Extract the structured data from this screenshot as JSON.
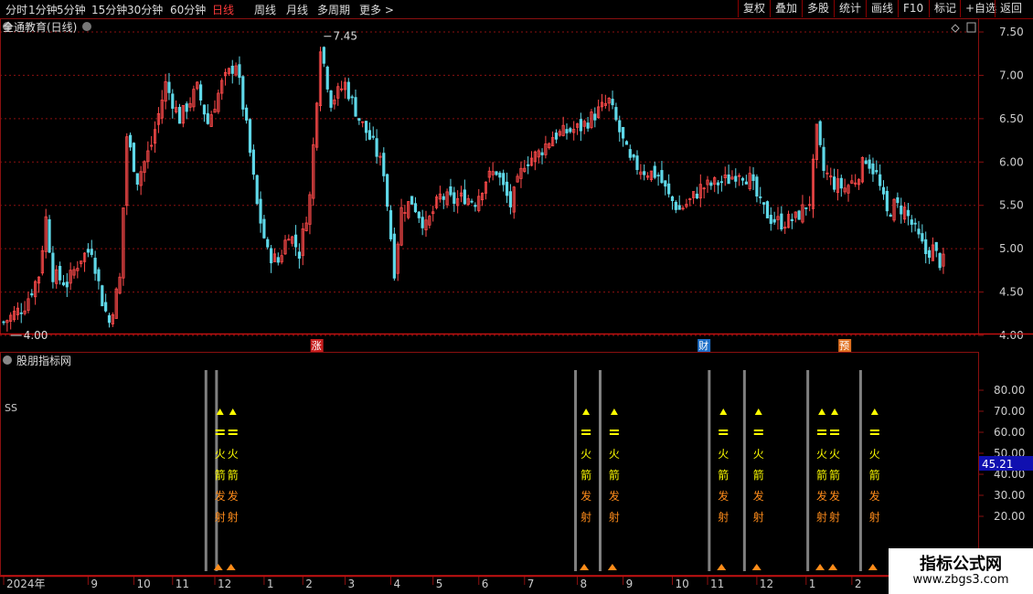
{
  "toolbar": {
    "periods": [
      "分时",
      "1分钟",
      "5分钟",
      "15分钟",
      "30分钟",
      "60分钟",
      "日线",
      "周线",
      "月线",
      "多周期",
      "更多"
    ],
    "active_period": "日线",
    "more_arrow": ">",
    "buttons": [
      "复权",
      "叠加",
      "多股",
      "统计",
      "画线",
      "F10",
      "标记",
      "+自选",
      "返回"
    ]
  },
  "main_panel": {
    "title": "全通教育(日线)",
    "max_label": "7.45",
    "min_label": "4.00",
    "event_tags": [
      {
        "text": "涨",
        "index": 89,
        "color": "#c81e1e"
      },
      {
        "text": "财",
        "index": 199,
        "color": "#1e6fc8"
      },
      {
        "text": "预",
        "index": 239,
        "color": "#e07020"
      }
    ]
  },
  "sub_panel": {
    "title": "股朋指标网",
    "label": "SS",
    "current_value": "45.21",
    "signal_text": [
      "火",
      "箭",
      "发",
      "射"
    ]
  },
  "watermark": {
    "line1": "指标公式网",
    "line2": "www.zbgs3.com"
  },
  "colors": {
    "up": "#ff4a4a",
    "down": "#5fd8e8",
    "grid": "#8a1010",
    "axis_text": "#cccccc",
    "signal_yellow": "#ffff00",
    "signal_orange": "#ff8c1a",
    "signal_bar": "#808080"
  },
  "chart_data": [
    {
      "type": "candlestick",
      "title": "全通教育(日线)",
      "ylim": [
        3.9,
        7.6
      ],
      "yticks": [
        "4.00",
        "4.50",
        "5.00",
        "5.50",
        "6.00",
        "6.50",
        "7.00",
        "7.50"
      ],
      "grid": true,
      "x_ticks": [
        {
          "label": "2024年",
          "index": 0
        },
        {
          "label": "9",
          "index": 24
        },
        {
          "label": "10",
          "index": 37
        },
        {
          "label": "11",
          "index": 48
        },
        {
          "label": "12",
          "index": 60
        },
        {
          "label": "1",
          "index": 74
        },
        {
          "label": "2",
          "index": 85
        },
        {
          "label": "3",
          "index": 97
        },
        {
          "label": "4",
          "index": 110
        },
        {
          "label": "5",
          "index": 122
        },
        {
          "label": "6",
          "index": 135
        },
        {
          "label": "7",
          "index": 148
        },
        {
          "label": "8",
          "index": 163
        },
        {
          "label": "9",
          "index": 176
        },
        {
          "label": "10",
          "index": 190
        },
        {
          "label": "11",
          "index": 200
        },
        {
          "label": "12",
          "index": 214
        },
        {
          "label": "1",
          "index": 228
        },
        {
          "label": "2",
          "index": 241
        }
      ],
      "close_path": [
        [
          0,
          4.15
        ],
        [
          6,
          4.35
        ],
        [
          10,
          4.7
        ],
        [
          12,
          5.35
        ],
        [
          14,
          4.7
        ],
        [
          18,
          4.6
        ],
        [
          22,
          4.9
        ],
        [
          25,
          5.0
        ],
        [
          28,
          4.4
        ],
        [
          30,
          4.15
        ],
        [
          33,
          4.65
        ],
        [
          35,
          6.3
        ],
        [
          38,
          5.8
        ],
        [
          42,
          6.2
        ],
        [
          46,
          6.9
        ],
        [
          50,
          6.5
        ],
        [
          55,
          6.85
        ],
        [
          58,
          6.45
        ],
        [
          62,
          6.9
        ],
        [
          66,
          7.15
        ],
        [
          69,
          6.4
        ],
        [
          72,
          5.5
        ],
        [
          75,
          4.95
        ],
        [
          78,
          4.85
        ],
        [
          81,
          5.2
        ],
        [
          84,
          4.95
        ],
        [
          87,
          5.6
        ],
        [
          90,
          7.35
        ],
        [
          93,
          6.7
        ],
        [
          97,
          6.9
        ],
        [
          101,
          6.5
        ],
        [
          105,
          6.2
        ],
        [
          108,
          5.9
        ],
        [
          111,
          4.75
        ],
        [
          113,
          5.45
        ],
        [
          116,
          5.55
        ],
        [
          120,
          5.25
        ],
        [
          124,
          5.6
        ],
        [
          128,
          5.55
        ],
        [
          131,
          5.6
        ],
        [
          134,
          5.55
        ],
        [
          137,
          5.8
        ],
        [
          140,
          5.9
        ],
        [
          144,
          5.5
        ],
        [
          148,
          6.0
        ],
        [
          152,
          6.1
        ],
        [
          156,
          6.3
        ],
        [
          160,
          6.35
        ],
        [
          164,
          6.4
        ],
        [
          168,
          6.55
        ],
        [
          172,
          6.7
        ],
        [
          175,
          6.35
        ],
        [
          178,
          6.0
        ],
        [
          182,
          5.9
        ],
        [
          186,
          5.85
        ],
        [
          189,
          5.6
        ],
        [
          192,
          5.45
        ],
        [
          195,
          5.55
        ],
        [
          198,
          5.7
        ],
        [
          202,
          5.75
        ],
        [
          206,
          5.8
        ],
        [
          209,
          5.9
        ],
        [
          212,
          5.8
        ],
        [
          215,
          5.5
        ],
        [
          218,
          5.35
        ],
        [
          221,
          5.3
        ],
        [
          225,
          5.35
        ],
        [
          229,
          5.55
        ],
        [
          231,
          6.35
        ],
        [
          233,
          5.9
        ],
        [
          236,
          5.75
        ],
        [
          239,
          5.7
        ],
        [
          242,
          5.8
        ],
        [
          245,
          6.05
        ],
        [
          248,
          5.85
        ],
        [
          251,
          5.4
        ],
        [
          253,
          5.5
        ],
        [
          256,
          5.45
        ],
        [
          259,
          5.2
        ],
        [
          262,
          4.95
        ],
        [
          264,
          5.0
        ],
        [
          266,
          4.85
        ]
      ]
    },
    {
      "type": "bar",
      "title": "股朋指标网",
      "ylim": [
        10,
        90
      ],
      "yticks": [
        "20.00",
        "30.00",
        "40.00",
        "50.00",
        "60.00",
        "70.00",
        "80.00"
      ],
      "current_value": 45.21,
      "signal_bar_indices": [
        58,
        61,
        163,
        170,
        201,
        211,
        229,
        244
      ],
      "signal_text_columns": [
        {
          "index": 62,
          "cols": 2
        },
        {
          "index": 166,
          "cols": 1
        },
        {
          "index": 174,
          "cols": 1
        },
        {
          "index": 205,
          "cols": 1
        },
        {
          "index": 215,
          "cols": 1
        },
        {
          "index": 233,
          "cols": 2
        },
        {
          "index": 248,
          "cols": 1
        }
      ]
    }
  ]
}
